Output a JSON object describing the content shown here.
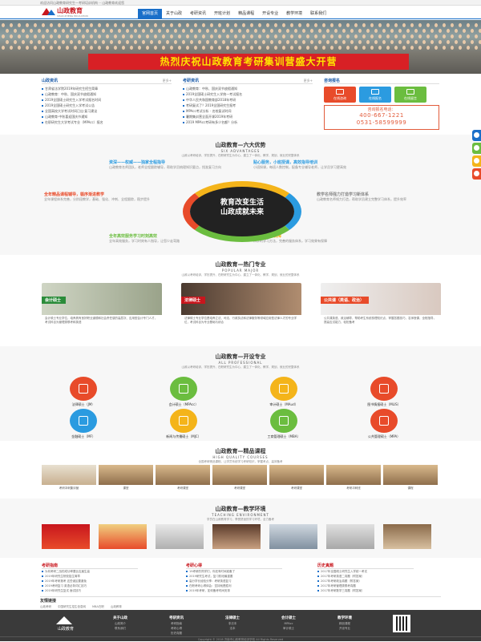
{
  "topbar": {
    "text": "欢迎访问山政教育研究生—考研培训机构 ·· 山政教育欢迎您"
  },
  "logo": {
    "name": "山政教育",
    "en": "SHAN ZHENG EDUCATION"
  },
  "nav": [
    "官网首页",
    "关于山政",
    "考研资讯",
    "开班计划",
    "精品课程",
    "开设专业",
    "教学环境",
    "联系我们"
  ],
  "banner": {
    "title": "热烈庆祝山政教育考研集训营盛大开营"
  },
  "news1": {
    "title": "山政资讯",
    "more": "更多+",
    "items": [
      "甘肃省法学院2019年研究生招生简章",
      "山政教育：中秋、国庆双节放假通知",
      "2019全国硕士研究生入学考试报名时间",
      "2019全国硕士研究生入学考试公告",
      "全国高校大学考试时间已出·复习建议",
      "山政教育·中秋喜迎国庆节通知",
      "在职研究生大学考试专业（MPAcc）报名"
    ]
  },
  "news2": {
    "title": "考研资讯",
    "more": "更多+",
    "items": [
      "山政教育：中秋、国庆双节放假通知",
      "2019全国硕士研究生入学统一考试报名",
      "中华人民共和国教育部2018年考研",
      "考研复试了？2019全国研究生报考",
      "MPAcc考试分析 · 名校复试时间",
      "暑期集训营全面开课2019年考研",
      "2019 MPAcc考研有多少名额？分析"
    ]
  },
  "consult": {
    "title": "咨询报名",
    "icons": [
      {
        "label": "在线咨询",
        "color": "#e84b2a"
      },
      {
        "label": "在线报名",
        "color": "#2b9be0"
      },
      {
        "label": "在线留言",
        "color": "#6bbd3f"
      }
    ],
    "phone_label": "咨询报名电话：",
    "phone1": "400-667-1221",
    "phone2": "0531-58599999"
  },
  "six": {
    "cn": "山政教育—六大优势",
    "en": "SIX ADVANTAGES",
    "desc": "山政以考研培训、学历提升、在职研究生为中心，建立了一体化、教学、规划、就业的完整体系",
    "center": "教育改变生活\n山政成就未来",
    "a1": {
      "h": "资深——权威——独家全程指导",
      "d": "山政教育名师团队，老师全程跟踪辅导，帮助学员梳理知识要点，找准复习方向"
    },
    "a2": {
      "h": "贴心服务，小班授课，高效指导培训",
      "d": "小班授课，每班人数控制，配备专业辅导老师，让学员学习更高效"
    },
    "a3": {
      "h": "全年精品课程辅导，循序渐进教学",
      "d": "全年课程体系完善，分阶段教学，基础、强化、冲刺、全程跟踪，稳步提升"
    },
    "a4": {
      "h": "教学名师强力打造学习新体系",
      "d": "山政教育名师倾力打造，帮助学员建立完整学习体系，提升效率"
    },
    "a5": {
      "h": "全年高效服务学习时刻高效",
      "d": "全年高效服务，学习时刻有人指导，让您少走弯路"
    },
    "a6": {
      "h": "学习效果有保障",
      "d": "科学的学习方法，完善的服务体系，学习效果有保障"
    }
  },
  "popular": {
    "cn": "山政教育—热门专业",
    "en": "POPULAR MAJOR",
    "desc": "山政以考研培训、学历提升、在职研究生为中心，建立了一体化、教学、规划、就业的完整体系",
    "cards": [
      {
        "tag": "会计硕士",
        "color": "#2b8c3a",
        "text": "会计硕士专业学位，培养具有良好职业道德和社会责任感的高层次、应用型会计专门人才，考试科目为管理类联考和英语"
      },
      {
        "tag": "法律硕士",
        "color": "#c8161d",
        "text": "法律硕士专业学位是培养立法、司法、行政执法和法律服务等领域应用型法律人才的专业学位，考试科目为专业基础与综合"
      },
      {
        "tag": "公共课（英语、政治）",
        "color": "#e84b2a",
        "text": "公共课英语、政治辅导，帮助考生系统梳理知识点，掌握答题技巧，名师授课，全程指导，提高应试能力，轻松备考"
      }
    ]
  },
  "majors": {
    "cn": "山政教育—开设专业",
    "en": "ALL PROFESSIONAL",
    "desc": "山政以考研培训、学历提升、在职研究生为中心，建立了一体化、教学、规划、就业的完整体系",
    "items": [
      {
        "label": "法律硕士（JM）",
        "color": "#e84b2a"
      },
      {
        "label": "会计硕士（MPAcc）",
        "color": "#6bbd3f"
      },
      {
        "label": "审计硕士（MAud）",
        "color": "#f4b41a"
      },
      {
        "label": "图书情报硕士（MLIS）",
        "color": "#e84b2a"
      },
      {
        "label": "金融硕士（MF）",
        "color": "#2b9be0"
      },
      {
        "label": "新闻与传播硕士（MJC）",
        "color": "#f4b41a"
      },
      {
        "label": "工商管理硕士（MBA）",
        "color": "#6bbd3f"
      },
      {
        "label": "公共管理硕士（MPA）",
        "color": "#e84b2a"
      }
    ]
  },
  "courses": {
    "cn": "山政教育—精品课程",
    "en": "HIGH QUALITY COURSES",
    "desc": "全国考研精品课程，让学员系统学习考研知识，掌握考点，高效备考",
    "items": [
      "考研冲刺集训营",
      "课堂",
      "考研课堂",
      "考研课堂",
      "考研课堂",
      "考研冲刺班",
      "课程"
    ]
  },
  "env": {
    "cn": "山政教育—教学环境",
    "en": "TEACHING ENVIRONMENT",
    "desc": "学员在山政教育学习，享受舒适的学习环境，全力备考"
  },
  "guide": {
    "title": "考研指南",
    "items": [
      "为何考研二战的成功率要比应届生高",
      "2019年研究生院校招生简章",
      "2019年考研报考 这些误区要避免",
      "2019考研复习 英语必背词汇技巧",
      "2019年研究生复试 面试技巧"
    ]
  },
  "exp": {
    "title": "考研心得",
    "items": [
      "19考研的同学们，你还有时间准备了",
      "2019研究生考试，复习阶段最重要",
      "高分学长经验分享：考研英语复习",
      "在职考研心得体会：坚持就是胜利",
      "2019年考研，如何备考时间安排"
    ]
  },
  "past": {
    "title": "历史真题",
    "items": [
      "2017年全国硕士研究生入学统一考试",
      "2017年考研英语二真题（附答案）",
      "2017年考研政治真题（附答案）",
      "2017年考研管理类联考真题",
      "2017年考研数学三真题（附答案）"
    ]
  },
  "links": {
    "title": "友情链接",
    "items": [
      "山政考研",
      "中国研究生招生信息网",
      "MBA在职",
      "山政教育"
    ]
  },
  "footer": {
    "logo": "山政教育",
    "cols": [
      {
        "h": "关于山政",
        "items": [
          "山政简介",
          "联系我们"
        ]
      },
      {
        "h": "考研资讯",
        "items": [
          "考研指南",
          "考研心得",
          "历史真题"
        ]
      },
      {
        "h": "法律硕士",
        "items": [
          "非法本",
          "法本"
        ]
      },
      {
        "h": "会计硕士",
        "items": [
          "MPAcc",
          "审计硕士"
        ]
      },
      {
        "h": "教学环境",
        "items": [
          "精品课程",
          "开设专业"
        ]
      }
    ],
    "copy": "Copyright © 2018 济南市山政教育培训学校 All Rights Reserved"
  },
  "side": [
    {
      "color": "#1a6fc9"
    },
    {
      "color": "#6bbd3f"
    },
    {
      "color": "#f4b41a"
    },
    {
      "color": "#e84b2a"
    }
  ]
}
